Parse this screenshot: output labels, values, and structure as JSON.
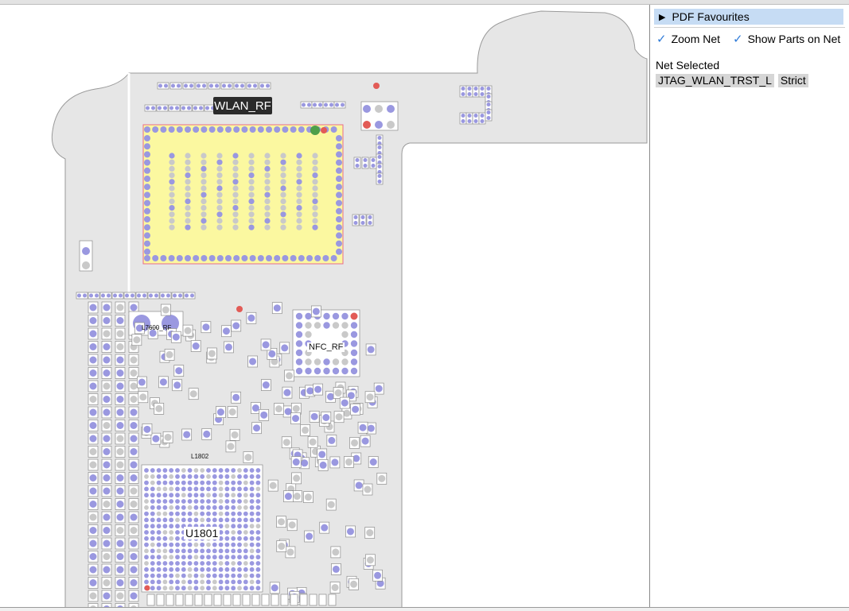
{
  "sidebar": {
    "favourites_label": "PDF Favourites",
    "zoom_net_label": "Zoom Net",
    "show_parts_label": "Show Parts on Net",
    "net_selected_title": "Net Selected",
    "net_name": "JTAG_WLAN_TRST_L",
    "match_mode": "Strict"
  },
  "board": {
    "wlan_label": "WLAN_RF",
    "nfc_label": "NFC_RF",
    "u1801_label": "U1801",
    "l7600_label": "L7600_RF",
    "l1802_label": "L1802"
  },
  "colors": {
    "board_fill": "#e6e6e6",
    "pad_blue": "#9a98e0",
    "pad_gray": "#c9c9c9",
    "pad_red": "#e25b56",
    "pad_green": "#4e9f49",
    "chip_yellow": "#fbf8a0",
    "selection_blue": "#c6dcf4",
    "check_blue": "#2f7bd8"
  },
  "icons": [
    "disclosure-triangle-icon",
    "checkmark-icon"
  ]
}
